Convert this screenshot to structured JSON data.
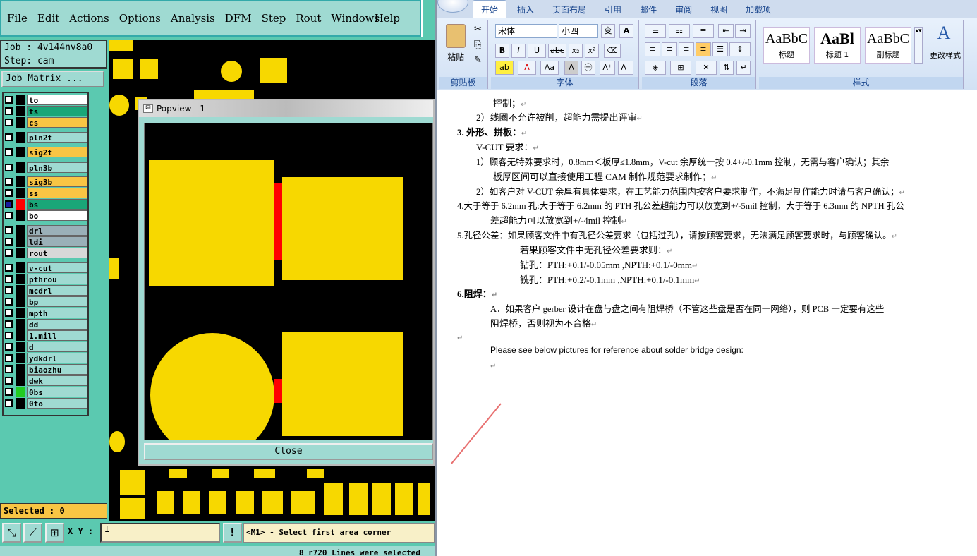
{
  "cam": {
    "menu": [
      "File",
      "Edit",
      "Actions",
      "Options",
      "Analysis",
      "DFM",
      "Step",
      "Rout",
      "Windows"
    ],
    "help": "Help",
    "job": "Job : 4v144nv8a0",
    "step": "Step: cam",
    "job_matrix": "Job Matrix ...",
    "layers": [
      {
        "name": "to",
        "color": "#ffffff"
      },
      {
        "name": "ts",
        "color": "#1aa678"
      },
      {
        "name": "cs",
        "color": "#f8c544"
      },
      {
        "name": "pln2t",
        "color": "#9fdad2"
      },
      {
        "name": "sig2t",
        "color": "#f8c544"
      },
      {
        "name": "pln3b",
        "color": "#9fdad2"
      },
      {
        "name": "sig3b",
        "color": "#f8c544"
      },
      {
        "name": "ss",
        "color": "#f8c544"
      },
      {
        "name": "bs",
        "color": "#1aa678"
      },
      {
        "name": "bo",
        "color": "#ffffff"
      },
      {
        "name": "drl",
        "color": "#9ab0b8"
      },
      {
        "name": "ldi",
        "color": "#9ab0b8"
      },
      {
        "name": "rout",
        "color": "#d8d8d8"
      },
      {
        "name": "v-cut",
        "color": "#9fdad2"
      },
      {
        "name": "pthrou",
        "color": "#9fdad2"
      },
      {
        "name": "mcdrl",
        "color": "#9fdad2"
      },
      {
        "name": "bp",
        "color": "#9fdad2"
      },
      {
        "name": "mpth",
        "color": "#9fdad2"
      },
      {
        "name": "dd",
        "color": "#9fdad2"
      },
      {
        "name": "1.mill",
        "color": "#9fdad2"
      },
      {
        "name": "d",
        "color": "#9fdad2"
      },
      {
        "name": "ydkdrl",
        "color": "#9fdad2"
      },
      {
        "name": "biaozhu",
        "color": "#9fdad2"
      },
      {
        "name": "dwk",
        "color": "#9fdad2"
      },
      {
        "name": "0bs",
        "color": "#9fdad2"
      },
      {
        "name": "0to",
        "color": "#9fdad2"
      }
    ],
    "selected": "Selected : 0",
    "popview_title": "Popview - 1",
    "close": "Close",
    "xy_label": "X Y :",
    "xy_value": "I",
    "prompt": "<M1> - Select first area corner",
    "status": "8 r720 Lines were selected",
    "colors": {
      "pad": "#f7d800",
      "bridge": "#ff0000",
      "panel": "#5bc9b0"
    }
  },
  "word": {
    "tabs": [
      "开始",
      "插入",
      "页面布局",
      "引用",
      "邮件",
      "审阅",
      "视图",
      "加载项"
    ],
    "groups": {
      "clipboard": "剪贴板",
      "font": "字体",
      "paragraph": "段落",
      "styles": "样式"
    },
    "paste": "粘贴",
    "font_name": "宋体",
    "font_size": "小四",
    "styles": [
      {
        "sample": "AaBbC",
        "label": "标题"
      },
      {
        "sample": "AaBl",
        "label": "标题 1"
      },
      {
        "sample": "AaBbC",
        "label": "副标题"
      }
    ],
    "change_styles": "更改样式",
    "lines": [
      "控制；",
      "2）线圈不允许被削，超能力需提出评审",
      "3.   外形、拼板：",
      "V-CUT 要求：",
      "1）顾客无特殊要求时，0.8mm＜板厚≤1.8mm，V-cut 余厚统一按 0.4+/-0.1mm 控制，无需与客户确认；其余",
      "板厚区间可以直接使用工程 CAM 制作规范要求制作；",
      "2）如客户对 V-CUT 余厚有具体要求，在工艺能力范围内按客户要求制作，不满足制作能力时请与客户确认；",
      "4.大于等于 6.2mm 孔:大于等于 6.2mm 的 PTH 孔公差超能力可以放宽到+/-5mil 控制，大于等于 6.3mm 的 NPTH 孔公",
      "差超能力可以放宽到+/-4mil 控制",
      "5.孔径公差：如果顾客文件中有孔径公差要求（包括过孔），请按顾客要求，无法满足顾客要求时，与顾客确认。",
      "若果顾客文件中无孔径公差要求则：",
      "钻孔：PTH:+0.1/-0.05mm  ,NPTH:+0.1/-0mm",
      "铣孔：PTH:+0.2/-0.1mm  ,NPTH:+0.1/-0.1mm",
      "6.阻焊：",
      "A．如果客户 gerber 设计在盘与盘之间有阻焊桥（不管这些盘是否在同一网络），则 PCB 一定要有这些",
      "阻焊桥，否则视为不合格",
      "Please see below pictures for reference about solder bridge design:"
    ],
    "para_mark": "↵"
  }
}
